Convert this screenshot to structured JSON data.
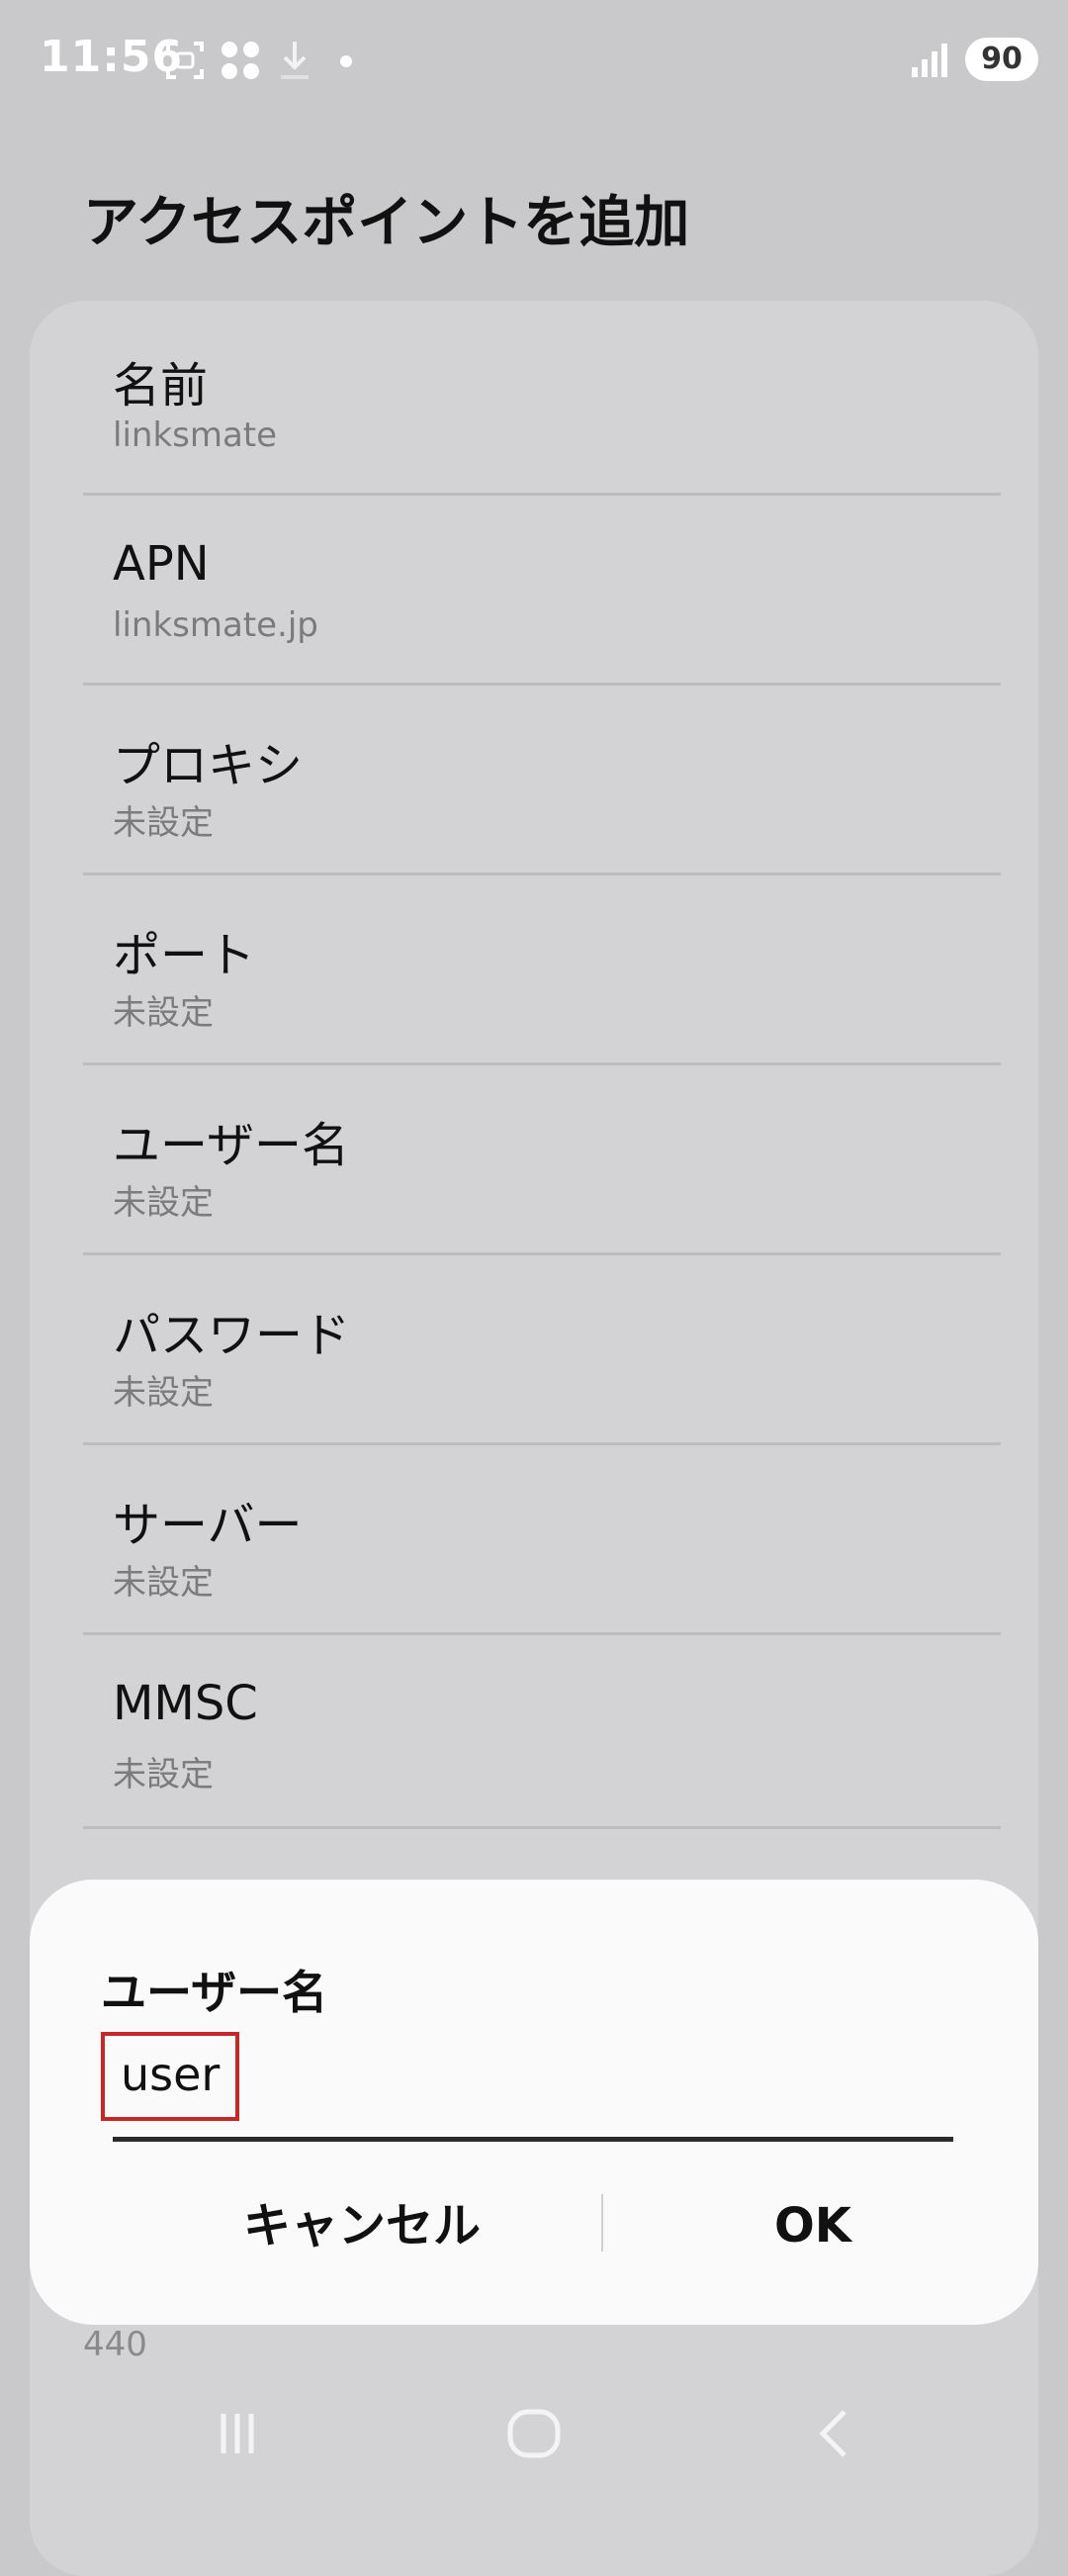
{
  "status": {
    "time": "11:56",
    "battery": "90"
  },
  "page": {
    "title": "アクセスポイントを追加"
  },
  "rows": [
    {
      "label": "名前",
      "value": "linksmate"
    },
    {
      "label": "APN",
      "value": "linksmate.jp"
    },
    {
      "label": "プロキシ",
      "value": "未設定"
    },
    {
      "label": "ポート",
      "value": "未設定"
    },
    {
      "label": "ユーザー名",
      "value": "未設定"
    },
    {
      "label": "パスワード",
      "value": "未設定"
    },
    {
      "label": "サーバー",
      "value": "未設定"
    },
    {
      "label": "MMSC",
      "value": "未設定"
    }
  ],
  "peek": {
    "value": "440"
  },
  "dialog": {
    "title": "ユーザー名",
    "input_value": "user",
    "cancel_label": "キャンセル",
    "ok_label": "OK"
  },
  "colors": {
    "highlight_box": "#c62828",
    "background_dim": "#c9c9cb",
    "dialog_bg": "#fafafb"
  },
  "icons": [
    "screenshot-icon",
    "apps-icon",
    "download-icon",
    "notification-dot-icon",
    "signal-icon",
    "battery-icon",
    "recents-icon",
    "home-icon",
    "back-icon"
  ]
}
